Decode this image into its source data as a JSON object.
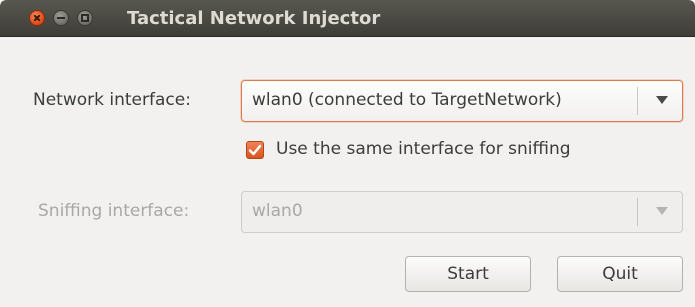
{
  "window": {
    "title": "Tactical Network Injector"
  },
  "network": {
    "label": "Network interface:",
    "selected": "wlan0 (connected to TargetNetwork)"
  },
  "same_interface": {
    "label": "Use the same interface for sniffing",
    "checked": true
  },
  "sniffing": {
    "label": "Sniffing interface:",
    "selected": "wlan0",
    "disabled": true
  },
  "buttons": {
    "start": "Start",
    "quit": "Quit"
  },
  "colors": {
    "accent": "#dd4814",
    "titlebar": "#3e3d38",
    "window_bg": "#f2f1f0"
  }
}
